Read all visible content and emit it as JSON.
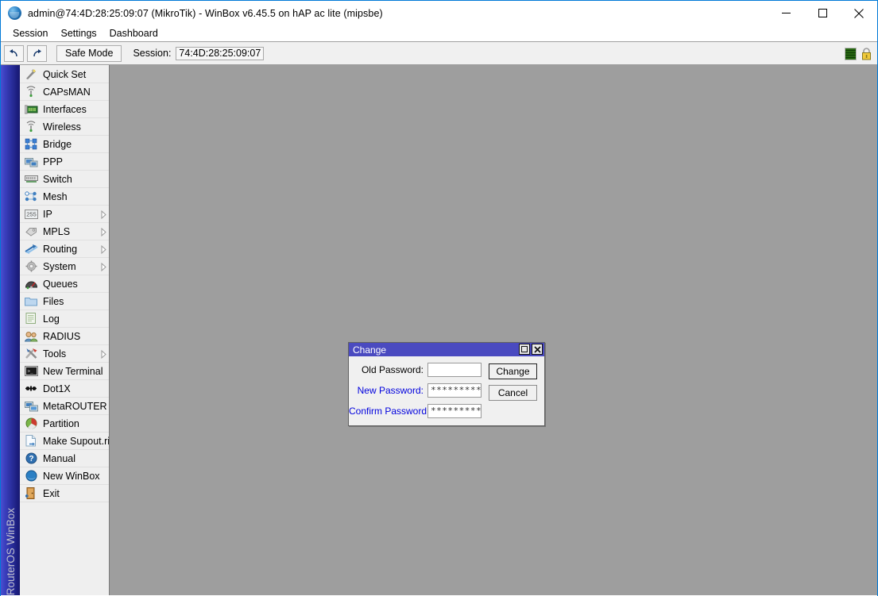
{
  "window": {
    "title": "admin@74:4D:28:25:09:07 (MikroTik) - WinBox v6.45.5 on hAP ac lite (mipsbe)",
    "app_icon": "winbox-globe-icon",
    "minimize_label": "Minimize",
    "maximize_label": "Maximize",
    "close_label": "Close"
  },
  "menubar": {
    "items": [
      {
        "label": "Session"
      },
      {
        "label": "Settings"
      },
      {
        "label": "Dashboard"
      }
    ]
  },
  "toolbar": {
    "undo_icon": "undo-icon",
    "redo_icon": "redo-icon",
    "safe_mode_label": "Safe Mode",
    "session_label": "Session:",
    "session_value": "74:4D:28:25:09:07",
    "status_graph_icon": "green-bars-icon",
    "status_lock_icon": "yellow-padlock-icon"
  },
  "sidebar": {
    "strip_text": "RouterOS WinBox",
    "items": [
      {
        "label": "Quick Set",
        "icon": "wand-icon",
        "submenu": false
      },
      {
        "label": "CAPsMAN",
        "icon": "antenna-icon",
        "submenu": false
      },
      {
        "label": "Interfaces",
        "icon": "nic-card-icon",
        "submenu": false
      },
      {
        "label": "Wireless",
        "icon": "antenna-icon",
        "submenu": false
      },
      {
        "label": "Bridge",
        "icon": "bridge-icon",
        "submenu": false
      },
      {
        "label": "PPP",
        "icon": "ppp-monitor-icon",
        "submenu": false
      },
      {
        "label": "Switch",
        "icon": "switch-icon",
        "submenu": false
      },
      {
        "label": "Mesh",
        "icon": "mesh-icon",
        "submenu": false
      },
      {
        "label": "IP",
        "icon": "ip-255-icon",
        "submenu": true
      },
      {
        "label": "MPLS",
        "icon": "tags-icon",
        "submenu": true
      },
      {
        "label": "Routing",
        "icon": "routing-icon",
        "submenu": true
      },
      {
        "label": "System",
        "icon": "gear-icon",
        "submenu": true
      },
      {
        "label": "Queues",
        "icon": "queues-icon",
        "submenu": false
      },
      {
        "label": "Files",
        "icon": "folder-icon",
        "submenu": false
      },
      {
        "label": "Log",
        "icon": "log-icon",
        "submenu": false
      },
      {
        "label": "RADIUS",
        "icon": "users-icon",
        "submenu": false
      },
      {
        "label": "Tools",
        "icon": "tools-icon",
        "submenu": true
      },
      {
        "label": "New Terminal",
        "icon": "terminal-icon",
        "submenu": false
      },
      {
        "label": "Dot1X",
        "icon": "dot1x-icon",
        "submenu": false
      },
      {
        "label": "MetaROUTER",
        "icon": "metarouter-icon",
        "submenu": false
      },
      {
        "label": "Partition",
        "icon": "partition-icon",
        "submenu": false
      },
      {
        "label": "Make Supout.rif",
        "icon": "document-out-icon",
        "submenu": false
      },
      {
        "label": "Manual",
        "icon": "help-icon",
        "submenu": false
      },
      {
        "label": "New WinBox",
        "icon": "winbox-globe-icon",
        "submenu": false
      },
      {
        "label": "Exit",
        "icon": "exit-door-icon",
        "submenu": false
      }
    ]
  },
  "dialog": {
    "title": "Change",
    "restore_icon": "restore-window-icon",
    "close_icon": "close-icon",
    "fields": [
      {
        "label": "Old Password:",
        "value": "",
        "modified": false
      },
      {
        "label": "New Password:",
        "value": "*********",
        "modified": true
      },
      {
        "label": "Confirm Password:",
        "value": "*********",
        "modified": true
      }
    ],
    "buttons": [
      {
        "label": "Change",
        "primary": true
      },
      {
        "label": "Cancel",
        "primary": false
      }
    ]
  },
  "colors": {
    "title_accent": "#0078d7",
    "dialog_title": "#4a4ac0",
    "sidebar_strip": "#2a2f9e",
    "workarea_bg": "#9e9e9e",
    "modified_label": "#0000dd"
  }
}
